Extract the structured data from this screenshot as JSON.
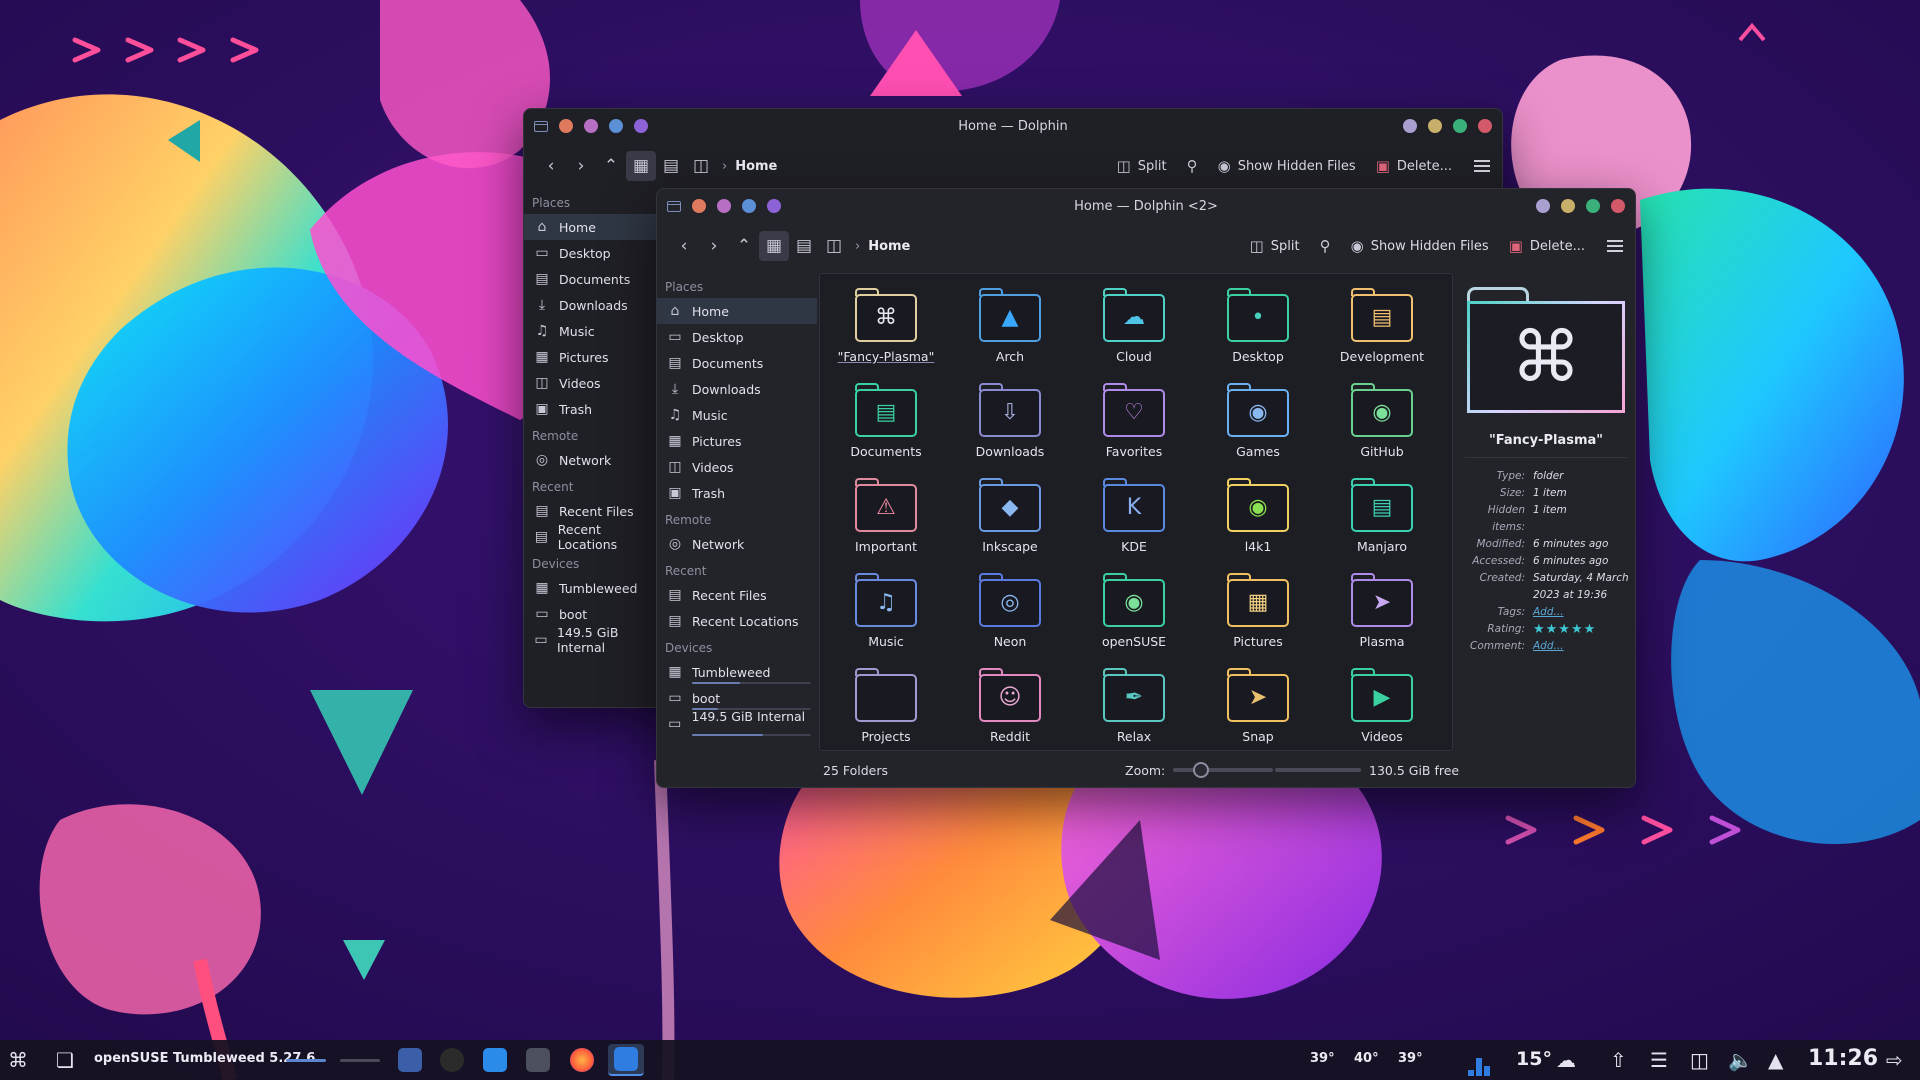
{
  "colors": {
    "accent": "#4fd1c5",
    "selection": "#2f3744",
    "window_bg": "#23232a",
    "link": "#5aa7d6",
    "rating": "#3ec6d3"
  },
  "back_window": {
    "title": "Home — Dolphin",
    "breadcrumb": "Home",
    "actions": {
      "split": "Split",
      "show_hidden": "Show Hidden Files",
      "delete": "Delete..."
    },
    "sidebar": {
      "places_title": "Places",
      "places": [
        "Home",
        "Desktop",
        "Documents",
        "Downloads",
        "Music",
        "Pictures",
        "Videos",
        "Trash"
      ],
      "remote_title": "Remote",
      "remote": [
        "Network"
      ],
      "recent_title": "Recent",
      "recent": [
        "Recent Files",
        "Recent Locations"
      ],
      "devices_title": "Devices",
      "devices": [
        "Tumbleweed",
        "boot",
        "149.5 GiB Internal"
      ]
    }
  },
  "front_window": {
    "title": "Home — Dolphin <2>",
    "breadcrumb": "Home",
    "actions": {
      "split": "Split",
      "show_hidden": "Show Hidden Files",
      "delete": "Delete..."
    },
    "sidebar": {
      "places_title": "Places",
      "places": [
        "Home",
        "Desktop",
        "Documents",
        "Downloads",
        "Music",
        "Pictures",
        "Videos",
        "Trash"
      ],
      "remote_title": "Remote",
      "remote": [
        "Network"
      ],
      "recent_title": "Recent",
      "recent": [
        "Recent Files",
        "Recent Locations"
      ],
      "devices_title": "Devices",
      "devices": [
        "Tumbleweed",
        "boot",
        "149.5 GiB Internal ..."
      ]
    },
    "folders": [
      {
        "name": "\"Fancy-Plasma\"",
        "icon": "command-icon"
      },
      {
        "name": "Arch",
        "icon": "arch-logo-icon"
      },
      {
        "name": "Cloud",
        "icon": "cloud-icon"
      },
      {
        "name": "Desktop",
        "icon": "desktop-icon"
      },
      {
        "name": "Development",
        "icon": "development-icon"
      },
      {
        "name": "Documents",
        "icon": "document-icon"
      },
      {
        "name": "Downloads",
        "icon": "download-icon"
      },
      {
        "name": "Favorites",
        "icon": "heart-icon"
      },
      {
        "name": "Games",
        "icon": "gamepad-icon"
      },
      {
        "name": "GitHub",
        "icon": "github-icon"
      },
      {
        "name": "Important",
        "icon": "warning-icon"
      },
      {
        "name": "Inkscape",
        "icon": "inkscape-icon"
      },
      {
        "name": "KDE",
        "icon": "kde-icon"
      },
      {
        "name": "l4k1",
        "icon": "chameleon-icon"
      },
      {
        "name": "Manjaro",
        "icon": "manjaro-icon"
      },
      {
        "name": "Music",
        "icon": "music-note-icon"
      },
      {
        "name": "Neon",
        "icon": "neon-icon"
      },
      {
        "name": "openSUSE",
        "icon": "opensuse-icon"
      },
      {
        "name": "Pictures",
        "icon": "picture-icon"
      },
      {
        "name": "Plasma",
        "icon": "plasma-icon"
      },
      {
        "name": "Projects",
        "icon": "folder-icon"
      },
      {
        "name": "Reddit",
        "icon": "reddit-icon"
      },
      {
        "name": "Relax",
        "icon": "feather-icon"
      },
      {
        "name": "Snap",
        "icon": "snap-bird-icon"
      },
      {
        "name": "Videos",
        "icon": "video-icon"
      }
    ],
    "info": {
      "name": "\"Fancy-Plasma\"",
      "type_label": "Type:",
      "type": "folder",
      "size_label": "Size:",
      "size": "1 item",
      "hidden_label": "Hidden items:",
      "hidden": "1 item",
      "modified_label": "Modified:",
      "modified": "6 minutes ago",
      "accessed_label": "Accessed:",
      "accessed": "6 minutes ago",
      "created_label": "Created:",
      "created": "Saturday, 4 March 2023 at 19:36",
      "tags_label": "Tags:",
      "tags": "Add...",
      "rating_label": "Rating:",
      "rating": 0,
      "comment_label": "Comment:",
      "comment": "Add..."
    },
    "status": {
      "folders": "25 Folders",
      "zoom_label": "Zoom:",
      "free": "130.5 GiB free"
    }
  },
  "taskbar": {
    "activity": "openSUSE Tumbleweed 5.27.6",
    "temps": [
      "39°",
      "40°",
      "39°"
    ],
    "weather": "15°",
    "clock": "11:26"
  }
}
